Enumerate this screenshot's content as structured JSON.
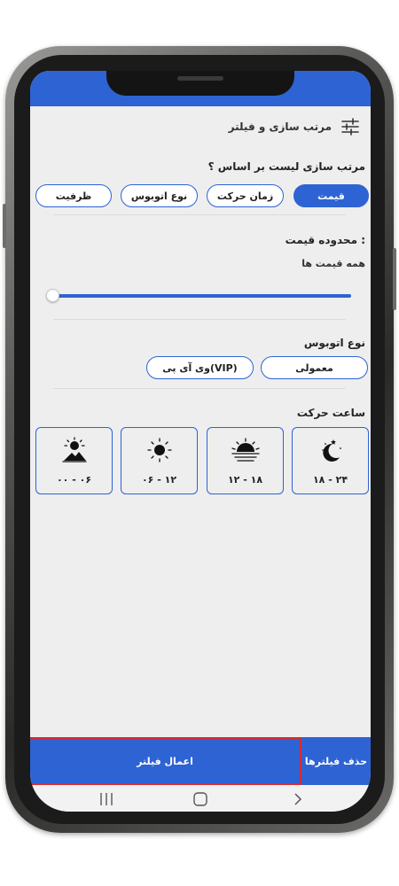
{
  "header": {
    "title": "مرتب سازی و فیلتر",
    "icon": "sliders-icon"
  },
  "sort": {
    "title": "مرتب سازی لیست بر اساس ؟",
    "options": [
      {
        "label": "قیمت",
        "active": true
      },
      {
        "label": "زمان حرکت",
        "active": false
      },
      {
        "label": "نوع اتوبوس",
        "active": false
      },
      {
        "label": "ظرفیت",
        "active": false
      }
    ]
  },
  "price": {
    "title": "محدوده قیمت :",
    "value_label": "همه قیمت ها",
    "slider_level": 0
  },
  "bus_type": {
    "title": "نوع اتوبوس",
    "options": [
      {
        "label": "معمولی"
      },
      {
        "label": "وی آی پی(VIP)"
      }
    ]
  },
  "departure": {
    "title": "ساعت حرکت",
    "slots": [
      {
        "label": "۱۸ - ۲۴",
        "icon": "moon-icon"
      },
      {
        "label": "۱۲ - ۱۸",
        "icon": "sunset-icon"
      },
      {
        "label": "۰۶ - ۱۲",
        "icon": "sun-icon"
      },
      {
        "label": "۰۰ - ۰۶",
        "icon": "sunrise-icon"
      }
    ]
  },
  "actions": {
    "apply": "اعمال فیلتر",
    "clear": "حذف فیلترها"
  },
  "colors": {
    "primary": "#2e63d4",
    "highlight": "#d9292b",
    "background": "#eeeeee"
  }
}
